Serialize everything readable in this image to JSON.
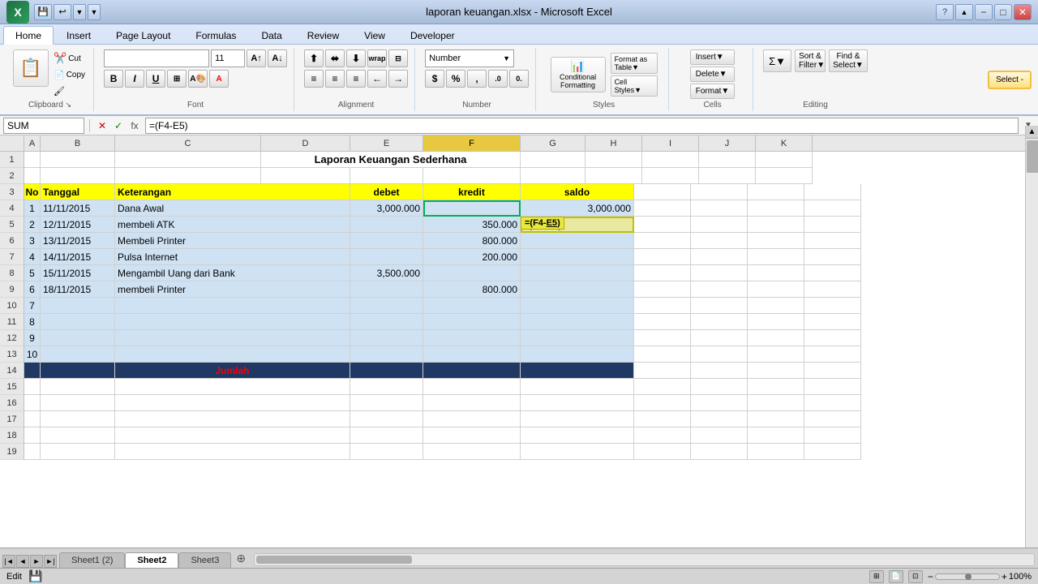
{
  "titleBar": {
    "title": "laporan keuangan.xlsx - Microsoft Excel",
    "buttons": [
      "−",
      "□",
      "✕"
    ]
  },
  "ribbonTabs": [
    "Home",
    "Insert",
    "Page Layout",
    "Formulas",
    "Data",
    "Review",
    "View",
    "Developer"
  ],
  "activeTab": "Home",
  "fontGroup": {
    "fontName": "",
    "fontSize": "11",
    "label": "Font"
  },
  "alignmentGroup": {
    "label": "Alignment"
  },
  "numberGroup": {
    "format": "Number",
    "label": "Number"
  },
  "stylesGroup": {
    "label": "Styles"
  },
  "cellsGroup": {
    "label": "Cells"
  },
  "editingGroup": {
    "label": "Editing"
  },
  "formulaBar": {
    "nameBox": "SUM",
    "formula": "=(F4-E5)"
  },
  "columns": [
    "A",
    "B",
    "C",
    "D",
    "E",
    "F",
    "G",
    "H",
    "I",
    "J",
    "K"
  ],
  "rows": [
    {
      "num": "1",
      "cells": [
        "",
        "",
        "",
        "Laporan Keuangan Sederhana",
        "",
        "",
        "",
        "",
        "",
        "",
        ""
      ]
    },
    {
      "num": "2",
      "cells": [
        "",
        "",
        "",
        "",
        "",
        "",
        "",
        "",
        "",
        "",
        ""
      ]
    },
    {
      "num": "3",
      "cells": [
        "No",
        "Tanggal",
        "Keterangan",
        "",
        "debet",
        "kredit",
        "saldo",
        "",
        "",
        "",
        ""
      ]
    },
    {
      "num": "4",
      "cells": [
        "1",
        "11/11/2015",
        "Dana Awal",
        "",
        "3,000.000",
        "",
        "3,000.000",
        "",
        "",
        "",
        ""
      ]
    },
    {
      "num": "5",
      "cells": [
        "2",
        "12/11/2015",
        "membeli ATK",
        "",
        "",
        "350.000",
        "=(F4-E5)",
        "",
        "",
        "",
        ""
      ]
    },
    {
      "num": "6",
      "cells": [
        "3",
        "13/11/2015",
        "Membeli Printer",
        "",
        "",
        "800.000",
        "",
        "",
        "",
        "",
        ""
      ]
    },
    {
      "num": "7",
      "cells": [
        "4",
        "14/11/2015",
        "Pulsa Internet",
        "",
        "",
        "200.000",
        "",
        "",
        "",
        "",
        ""
      ]
    },
    {
      "num": "8",
      "cells": [
        "5",
        "15/11/2015",
        "Mengambil Uang dari Bank",
        "",
        "3,500.000",
        "",
        "",
        "",
        "",
        "",
        ""
      ]
    },
    {
      "num": "9",
      "cells": [
        "6",
        "18/11/2015",
        "membeli Printer",
        "",
        "",
        "800.000",
        "",
        "",
        "",
        "",
        ""
      ]
    },
    {
      "num": "10",
      "cells": [
        "7",
        "",
        "",
        "",
        "",
        "",
        "",
        "",
        "",
        "",
        ""
      ]
    },
    {
      "num": "11",
      "cells": [
        "8",
        "",
        "",
        "",
        "",
        "",
        "",
        "",
        "",
        "",
        ""
      ]
    },
    {
      "num": "12",
      "cells": [
        "9",
        "",
        "",
        "",
        "",
        "",
        "",
        "",
        "",
        "",
        ""
      ]
    },
    {
      "num": "13",
      "cells": [
        "10",
        "",
        "",
        "",
        "",
        "",
        "",
        "",
        "",
        "",
        ""
      ]
    },
    {
      "num": "14",
      "cells": [
        "",
        "",
        "Jumlah",
        "",
        "",
        "",
        "",
        "",
        "",
        "",
        ""
      ]
    },
    {
      "num": "15",
      "cells": [
        "",
        "",
        "",
        "",
        "",
        "",
        "",
        "",
        "",
        "",
        ""
      ]
    },
    {
      "num": "16",
      "cells": [
        "",
        "",
        "",
        "",
        "",
        "",
        "",
        "",
        "",
        "",
        ""
      ]
    },
    {
      "num": "17",
      "cells": [
        "",
        "",
        "",
        "",
        "",
        "",
        "",
        "",
        "",
        "",
        ""
      ]
    },
    {
      "num": "18",
      "cells": [
        "",
        "",
        "",
        "",
        "",
        "",
        "",
        "",
        "",
        "",
        ""
      ]
    },
    {
      "num": "19",
      "cells": [
        "",
        "",
        "",
        "",
        "",
        "",
        "",
        "",
        "",
        "",
        ""
      ]
    }
  ],
  "sheetTabs": [
    "Sheet1 (2)",
    "Sheet2",
    "Sheet3"
  ],
  "activeSheet": "Sheet2",
  "statusBar": {
    "mode": "Edit"
  },
  "formulaTooltip": "=(F4-E5)"
}
